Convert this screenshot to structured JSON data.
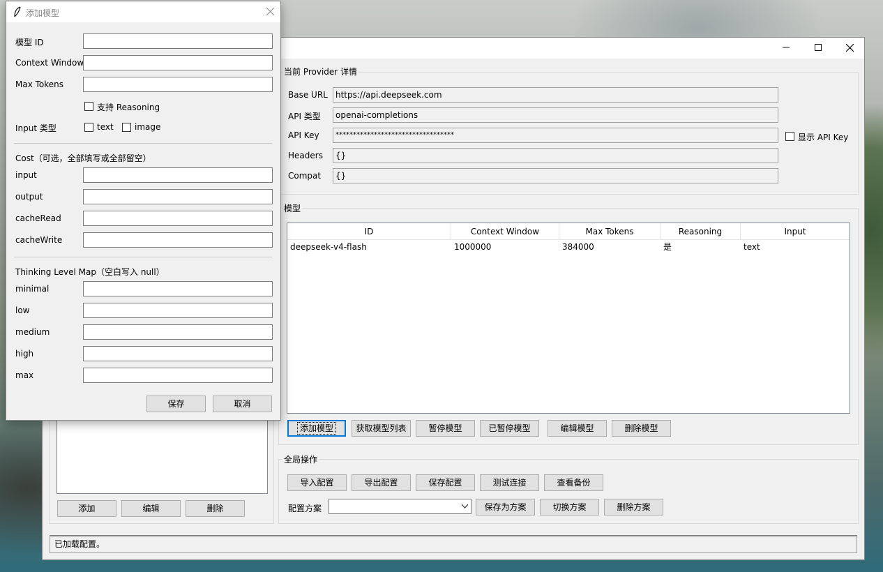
{
  "main_window": {
    "title": "",
    "provider_group": {
      "title": "当前 Provider 详情",
      "base_url_label": "Base URL",
      "base_url_value": "https://api.deepseek.com",
      "api_type_label": "API 类型",
      "api_type_value": "openai-completions",
      "api_key_label": "API Key",
      "api_key_value": "**********************************",
      "show_key_label": "显示 API Key",
      "headers_label": "Headers",
      "headers_value": "{}",
      "compat_label": "Compat",
      "compat_value": "{}"
    },
    "models_group": {
      "title": "模型",
      "columns": [
        "ID",
        "Context Window",
        "Max Tokens",
        "Reasoning",
        "Input"
      ],
      "rows": [
        [
          "deepseek-v4-flash",
          "1000000",
          "384000",
          "是",
          "text"
        ]
      ],
      "buttons": [
        "添加模型",
        "获取模型列表",
        "暂停模型",
        "已暂停模型",
        "编辑模型",
        "删除模型"
      ]
    },
    "global_group": {
      "title": "全局操作",
      "buttons": [
        "导入配置",
        "导出配置",
        "保存配置",
        "测试连接",
        "查看备份"
      ],
      "scheme_label": "配置方案",
      "scheme_value": "",
      "scheme_buttons": [
        "保存为方案",
        "切换方案",
        "删除方案"
      ]
    },
    "left_panel": {
      "buttons": [
        "添加",
        "编辑",
        "删除"
      ]
    },
    "status_text": "已加载配置。"
  },
  "dialog": {
    "title": "添加模型",
    "fields": {
      "model_id_label": "模型 ID",
      "context_window_label": "Context Window",
      "max_tokens_label": "Max Tokens",
      "reasoning_label": "支持 Reasoning",
      "input_type_label": "Input 类型",
      "input_text_label": "text",
      "input_image_label": "image"
    },
    "cost": {
      "title": "Cost（可选，全部填写或全部留空）",
      "labels": [
        "input",
        "output",
        "cacheRead",
        "cacheWrite"
      ]
    },
    "thinking": {
      "title": "Thinking Level Map（空白写入 null）",
      "labels": [
        "minimal",
        "low",
        "medium",
        "high",
        "max"
      ]
    },
    "save_label": "保存",
    "cancel_label": "取消"
  },
  "colors": {
    "window_bg": "#f0f0f0",
    "focus_accent": "#0078d7"
  }
}
